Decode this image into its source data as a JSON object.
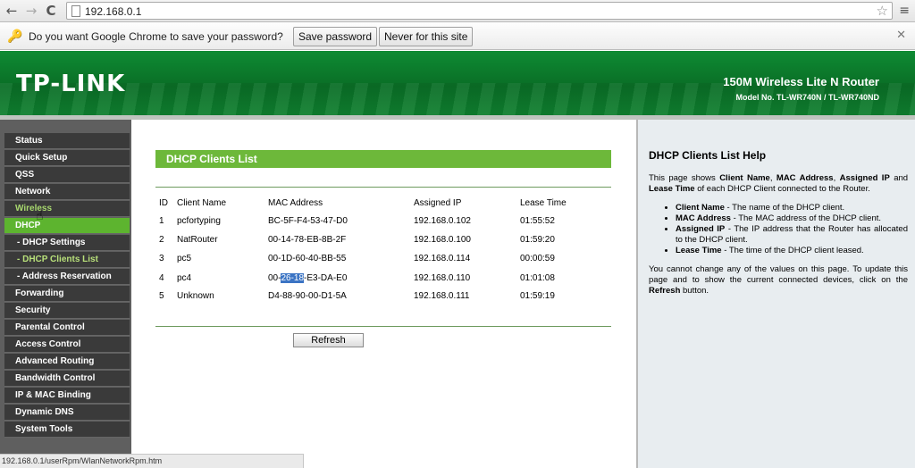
{
  "browser": {
    "url": "192.168.0.1",
    "back_icon": "←",
    "forward_icon": "→",
    "reload_icon": "C",
    "star_icon": "☆",
    "menu_icon": "≡",
    "infobar": {
      "key_icon": "🔑",
      "message": "Do you want Google Chrome to save your password?",
      "save_label": "Save password",
      "never_label": "Never for this site",
      "close_icon": "✕"
    },
    "status_url": "192.168.0.1/userRpm/WlanNetworkRpm.htm"
  },
  "banner": {
    "logo": "TP-LINK",
    "product": "150M Wireless Lite N Router",
    "model": "Model No. TL-WR740N / TL-WR740ND"
  },
  "sidebar": {
    "items": [
      {
        "label": "Status"
      },
      {
        "label": "Quick Setup"
      },
      {
        "label": "QSS"
      },
      {
        "label": "Network"
      },
      {
        "label": "Wireless"
      },
      {
        "label": "DHCP"
      },
      {
        "label": "- DHCP Settings"
      },
      {
        "label": "- DHCP Clients List"
      },
      {
        "label": "- Address Reservation"
      },
      {
        "label": "Forwarding"
      },
      {
        "label": "Security"
      },
      {
        "label": "Parental Control"
      },
      {
        "label": "Access Control"
      },
      {
        "label": "Advanced Routing"
      },
      {
        "label": "Bandwidth Control"
      },
      {
        "label": "IP & MAC Binding"
      },
      {
        "label": "Dynamic DNS"
      },
      {
        "label": "System Tools"
      }
    ]
  },
  "main": {
    "title": "DHCP Clients List",
    "columns": [
      "ID",
      "Client Name",
      "MAC Address",
      "Assigned IP",
      "Lease Time"
    ],
    "rows": [
      [
        "1",
        "pcfortyping",
        "BC-5F-F4-53-47-D0",
        "192.168.0.102",
        "01:55:52"
      ],
      [
        "2",
        "NatRouter",
        "00-14-78-EB-8B-2F",
        "192.168.0.100",
        "01:59:20"
      ],
      [
        "3",
        "pc5",
        "00-1D-60-40-BB-55",
        "192.168.0.114",
        "00:00:59"
      ],
      [
        "4",
        "pc4",
        "00-26-18-E3-DA-E0",
        "192.168.0.110",
        "01:01:08"
      ],
      [
        "5",
        "Unknown",
        "D4-88-90-00-D1-5A",
        "192.168.0.111",
        "01:59:19"
      ]
    ],
    "mac4_parts": [
      "00-",
      "26-18",
      "-E3-DA-E0"
    ],
    "refresh_label": "Refresh"
  },
  "help": {
    "title": "DHCP Clients List Help",
    "intro_parts": [
      "This page shows ",
      "Client Name",
      ", ",
      "MAC Address",
      ", ",
      "Assigned IP",
      " and ",
      "Lease Time",
      " of each DHCP Client connected to the Router."
    ],
    "items": [
      {
        "term": "Client Name",
        "desc": " - The name of the DHCP client."
      },
      {
        "term": "MAC Address",
        "desc": " - The MAC address of the DHCP client."
      },
      {
        "term": "Assigned IP",
        "desc": " - The IP address that the Router has allocated to the DHCP client."
      },
      {
        "term": "Lease Time",
        "desc": " - The time of the DHCP client leased."
      }
    ],
    "footer_parts": [
      "You cannot change any of the values on this page. To update this page and to show the current connected devices, click on the ",
      "Refresh",
      " button."
    ]
  }
}
